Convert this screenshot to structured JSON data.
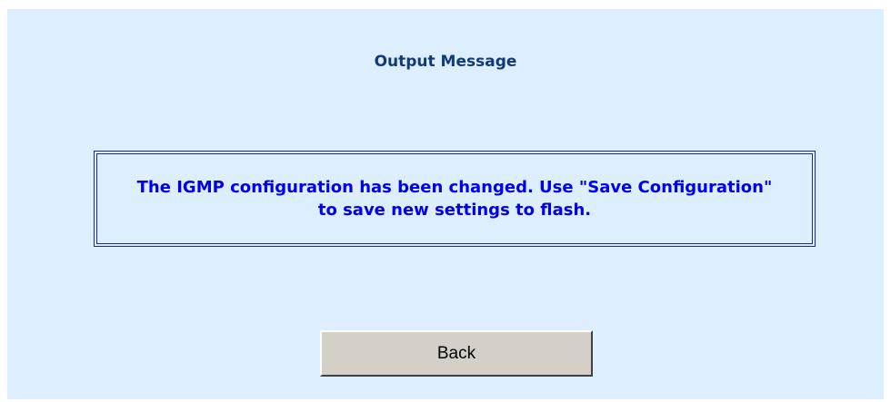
{
  "page": {
    "title": "Output Message"
  },
  "message": {
    "text": "The IGMP configuration has been changed. Use \"Save Configuration\" to save new settings to flash."
  },
  "actions": {
    "back_label": "Back"
  },
  "colors": {
    "panel_background": "#ddeeff",
    "title_color": "#123a78",
    "message_color": "#0000ee",
    "box_border": "#1a2a9a",
    "button_face": "#d4d0c8"
  }
}
